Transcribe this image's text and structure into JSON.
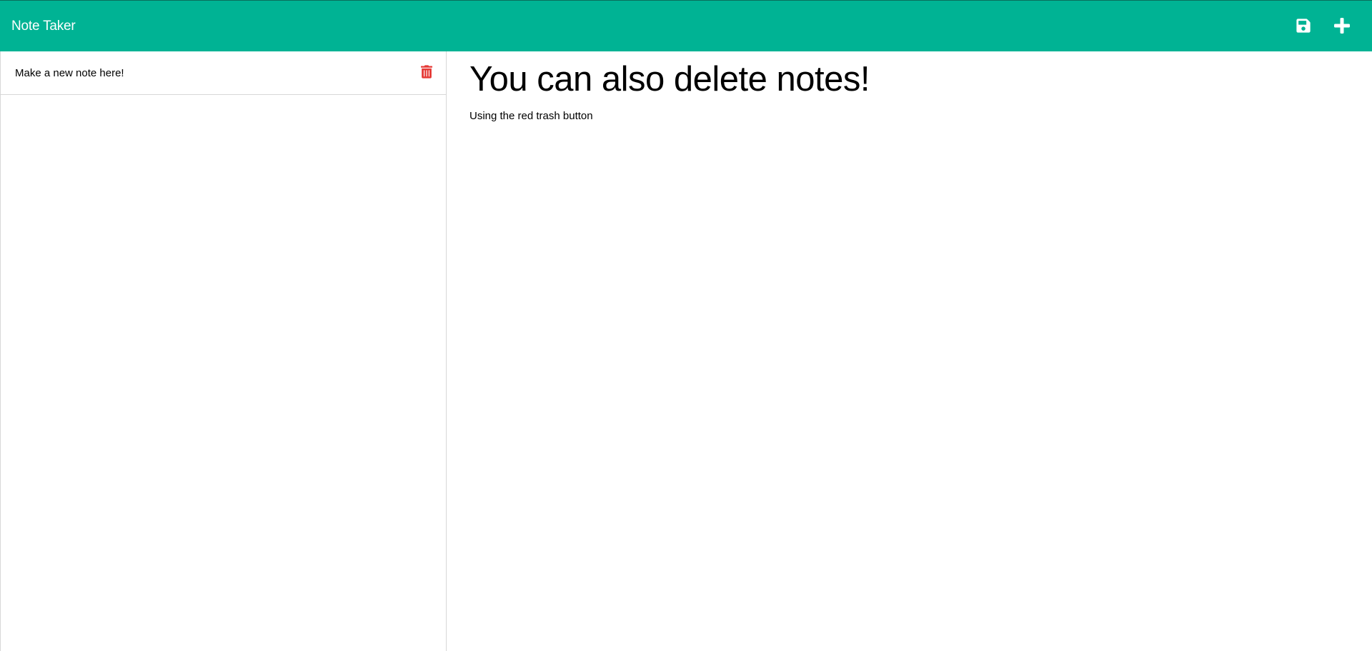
{
  "app": {
    "title": "Note Taker"
  },
  "toolbar": {
    "save_icon": "floppy-disk-save-icon",
    "add_icon": "plus-icon"
  },
  "notes_list": [
    {
      "title": "Make a new note here!",
      "delete_icon": "trash-icon"
    }
  ],
  "active_note": {
    "title": "You can also delete notes!",
    "text": "Using the red trash button"
  },
  "colors": {
    "navbar": "#00b394",
    "delete_icon": "#e53935",
    "divider": "#d7d7d7"
  }
}
